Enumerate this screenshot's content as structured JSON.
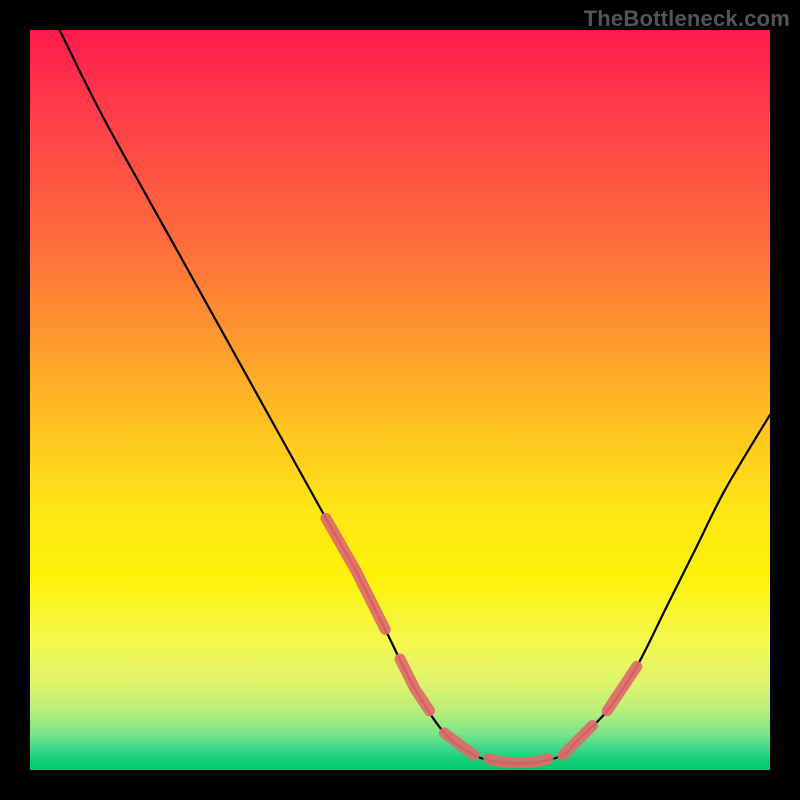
{
  "watermark": "TheBottleneck.com",
  "chart_data": {
    "type": "line",
    "title": "",
    "xlabel": "",
    "ylabel": "",
    "xlim": [
      0,
      100
    ],
    "ylim": [
      0,
      100
    ],
    "x": [
      4,
      10,
      20,
      30,
      40,
      44,
      48,
      52,
      56,
      60,
      64,
      68,
      72,
      74,
      78,
      82,
      86,
      90,
      94,
      100
    ],
    "values": [
      100,
      88,
      70,
      52,
      34,
      27,
      19,
      11,
      5,
      2,
      1,
      1,
      2,
      4,
      8,
      14,
      22,
      30,
      38,
      48
    ],
    "highlight_segments_x": [
      [
        40,
        48
      ],
      [
        50,
        54
      ],
      [
        56,
        60
      ],
      [
        62,
        70
      ],
      [
        72,
        76
      ],
      [
        78,
        82
      ]
    ],
    "gradient_stops": [
      {
        "pos": 0,
        "color": "#ff1a4d"
      },
      {
        "pos": 50,
        "color": "#ffc71f"
      },
      {
        "pos": 80,
        "color": "#fff20a"
      },
      {
        "pos": 97,
        "color": "#3fd98a"
      },
      {
        "pos": 100,
        "color": "#00c86a"
      }
    ]
  }
}
